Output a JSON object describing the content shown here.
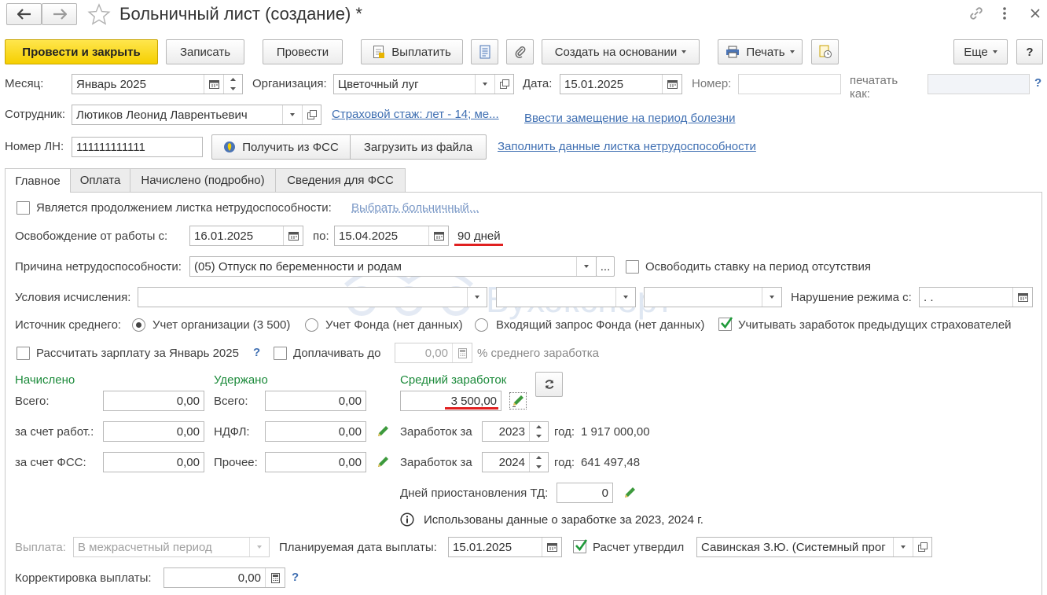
{
  "window": {
    "title": "Больничный лист (создание) *"
  },
  "toolbar": {
    "post_close": "Провести и закрыть",
    "save": "Записать",
    "post": "Провести",
    "pay": "Выплатить",
    "create_based": "Создать на основании",
    "print": "Печать",
    "more": "Еще",
    "help": "?"
  },
  "header": {
    "month_label": "Месяц:",
    "month_value": "Январь 2025",
    "org_label": "Организация:",
    "org_value": "Цветочный луг",
    "date_label": "Дата:",
    "date_value": "15.01.2025",
    "number_label": "Номер:",
    "number_value": "",
    "print_as_label": "печатать как:",
    "print_as_value": "",
    "help": "?",
    "employee_label": "Сотрудник:",
    "employee_value": "Лютиков Леонид Лаврентьевич",
    "insurance_link": "Страховой стаж: лет - 14; ме...",
    "substitution_link": "Ввести замещение на период болезни",
    "ln_label": "Номер ЛН:",
    "ln_value": "111111111111",
    "get_fss": "Получить из ФСС",
    "load_file": "Загрузить из файла",
    "fill_link": "Заполнить данные листка нетрудоспособности"
  },
  "tabs": [
    {
      "label": "Главное",
      "active": true
    },
    {
      "label": "Оплата",
      "active": false
    },
    {
      "label": "Начислено (подробно)",
      "active": false
    },
    {
      "label": "Сведения для ФСС",
      "active": false
    }
  ],
  "main": {
    "continuation_label": "Является продолжением листка нетрудоспособности:",
    "choose_sick_link": "Выбрать больничный...",
    "release_label": "Освобождение от работы с:",
    "release_from": "16.01.2025",
    "release_to_label": "по:",
    "release_to": "15.04.2025",
    "days": "90 дней",
    "reason_label": "Причина нетрудоспособности:",
    "reason_value": "(05) Отпуск по беременности и родам",
    "ellipsis": "...",
    "free_rate_label": "Освободить ставку на период отсутствия",
    "conditions_label": "Условия исчисления:",
    "cond1": "",
    "cond2": "",
    "cond3": "",
    "violation_label": "Нарушение режима с:",
    "violation_value": " .  .",
    "source_label": "Источник среднего:",
    "source_org": "Учет организации (3 500)",
    "source_fund": "Учет Фонда (нет данных)",
    "source_request": "Входящий запрос Фонда (нет данных)",
    "prev_insurers": "Учитывать заработок предыдущих страхователей",
    "calc_salary": "Рассчитать зарплату за Январь 2025",
    "q": "?",
    "topup_label": "Доплачивать до",
    "topup_value": "0,00",
    "topup_suffix": "% среднего заработка",
    "accrued_header": "Начислено",
    "withheld_header": "Удержано",
    "avg_header": "Средний заработок",
    "total_label": "Всего:",
    "accrued_total": "0,00",
    "withheld_total_label": "Всего:",
    "withheld_total": "0,00",
    "avg_value": "3 500,00",
    "employer_label": "за счет работ.:",
    "employer_value": "0,00",
    "ndfl_label": "НДФЛ:",
    "ndfl_value": "0,00",
    "fss_label": "за счет ФСС:",
    "fss_value": "0,00",
    "other_label": "Прочее:",
    "other_value": "0,00",
    "earn_label1": "Заработок за",
    "earn_year1": "2023",
    "earn_year_suffix1": "год:",
    "earn_amount1": "1 917 000,00",
    "earn_label2": "Заработок за",
    "earn_year2": "2024",
    "earn_year_suffix2": "год:",
    "earn_amount2": "641 497,48",
    "suspension_label": "Дней приостановления ТД:",
    "suspension_value": "0",
    "info_text": "Использованы данные о заработке за  2023,  2024 г."
  },
  "footer": {
    "payout_label": "Выплата:",
    "payout_value": "В межрасчетный период",
    "planned_label": "Планируемая дата выплаты:",
    "planned_value": "15.01.2025",
    "approved_label": "Расчет утвердил",
    "approved_value": "Савинская З.Ю. (Системный прог",
    "correction_label": "Корректировка выплаты:",
    "correction_value": "0,00",
    "q": "?"
  },
  "watermark": {
    "text": "Бухэксперт"
  },
  "colors": {
    "accent_yellow": "#f5cf00",
    "link_blue": "#3f6fb2",
    "header_green": "#1b8a3a",
    "highlight_red": "#e02020",
    "check_green": "#1f9a3a"
  }
}
